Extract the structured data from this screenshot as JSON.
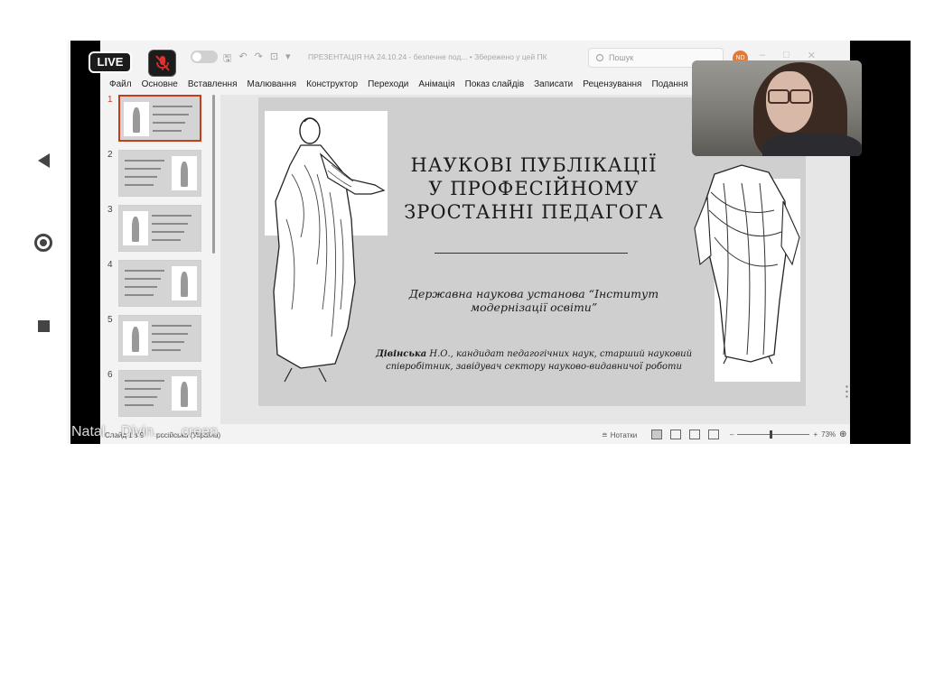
{
  "android_nav": {
    "back_icon": "back-triangle-icon",
    "home_icon": "home-circle-icon",
    "recents_icon": "recents-square-icon"
  },
  "stream": {
    "live_label": "LIVE",
    "mic_icon": "mic-muted-icon",
    "mic_color": "#e03030",
    "caption": "Natal... Divin... ...creen"
  },
  "titlebar": {
    "document_title": "ПРЕЗЕНТАЦІЯ НА 24.10.24 - безпечне под... • Збережено у цей ПК",
    "search_placeholder": "Пошук",
    "avatar_initials": "ND",
    "avatar_color": "#e07a3a"
  },
  "menu": [
    "Файл",
    "Основне",
    "Вставлення",
    "Малювання",
    "Конструктор",
    "Переходи",
    "Анімація",
    "Показ слайдів",
    "Записати",
    "Рецензування",
    "Подання",
    "Дов"
  ],
  "thumbnails": [
    {
      "num": "1",
      "active": true
    },
    {
      "num": "2",
      "active": false
    },
    {
      "num": "3",
      "active": false
    },
    {
      "num": "4",
      "active": false
    },
    {
      "num": "5",
      "active": false
    },
    {
      "num": "6",
      "active": false
    }
  ],
  "slide": {
    "title_lines": [
      "НАУКОВІ ПУБЛІКАЦІЇ",
      "У ПРОФЕСІЙНОМУ",
      "ЗРОСТАННІ ПЕДАГОГА"
    ],
    "subtitle": "Державна наукова установа “Інститут модернізації освіти”",
    "author_name": "Дівінська",
    "author_rest": " Н.О., кандидат педагогічних наук, старший науковий співробітник, завідувач сектору науково-видавничої роботи"
  },
  "statusbar": {
    "slide_counter": "Слайд 1 з 9",
    "language": "російська (Україна)",
    "notes_label": "Нотатки",
    "zoom": "73%"
  },
  "colors": {
    "accent": "#c43e1c",
    "slide_bg": "#cfcfcf",
    "ppt_chrome": "#f3f3f3"
  }
}
